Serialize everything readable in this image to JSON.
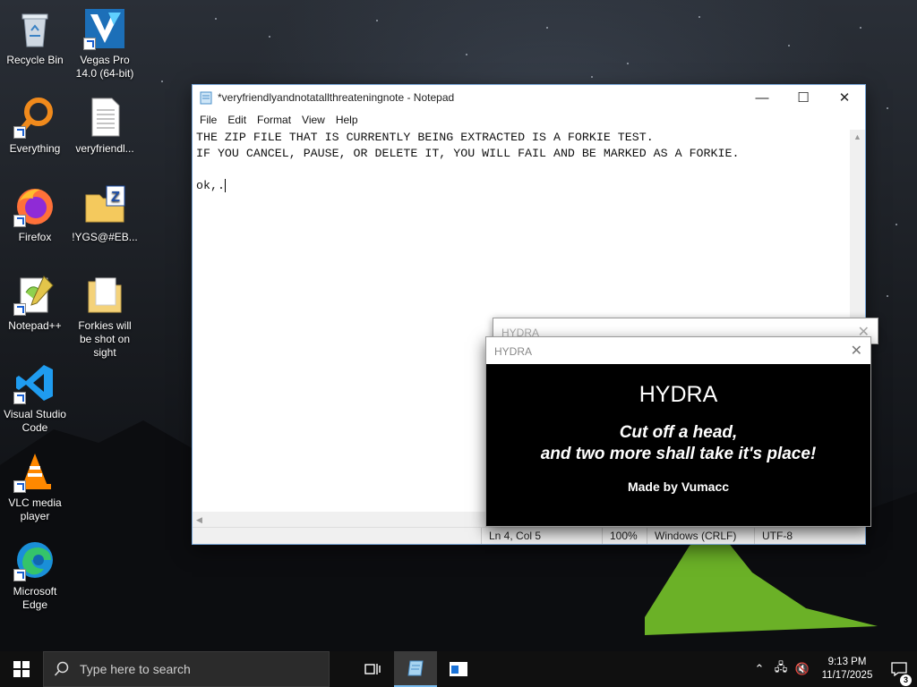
{
  "desktop": {
    "icons": [
      {
        "label": "Recycle Bin",
        "icon": "recycle-bin-icon"
      },
      {
        "label": "Vegas Pro 14.0 (64-bit)",
        "icon": "vegas-pro-icon"
      },
      {
        "label": "Everything",
        "icon": "everything-search-icon"
      },
      {
        "label": "veryfriendl...",
        "icon": "text-file-icon"
      },
      {
        "label": "Firefox",
        "icon": "firefox-icon"
      },
      {
        "label": "!YGS@#EB...",
        "icon": "zip-folder-icon"
      },
      {
        "label": "Notepad++",
        "icon": "notepadpp-icon"
      },
      {
        "label": "Forkies will be shot on sight",
        "icon": "folder-icon"
      },
      {
        "label": "Visual Studio Code",
        "icon": "vscode-icon"
      },
      {
        "label": "VLC media player",
        "icon": "vlc-icon"
      },
      {
        "label": "Microsoft Edge",
        "icon": "edge-icon"
      }
    ]
  },
  "notepad": {
    "title": "*veryfriendlyandnotatallthreateningnote - Notepad",
    "menu": [
      "File",
      "Edit",
      "Format",
      "View",
      "Help"
    ],
    "lines": [
      "THE ZIP FILE THAT IS CURRENTLY BEING EXTRACTED IS A FORKIE TEST.",
      "IF YOU CANCEL, PAUSE, OR DELETE IT, YOU WILL FAIL AND BE MARKED AS A FORKIE.",
      "",
      "ok,."
    ],
    "status": {
      "position": "Ln 4, Col 5",
      "zoom": "100%",
      "line_ending": "Windows (CRLF)",
      "encoding": "UTF-8"
    }
  },
  "hydra_back": {
    "title": "HYDRA"
  },
  "hydra": {
    "title": "HYDRA",
    "heading": "HYDRA",
    "line1": "Cut off a head,",
    "line2": "and two more shall take it's place!",
    "credit": "Made by Vumacc"
  },
  "taskbar": {
    "search_placeholder": "Type here to search",
    "time": "9:13 PM",
    "date": "11/17/2025",
    "notification_count": "3"
  }
}
